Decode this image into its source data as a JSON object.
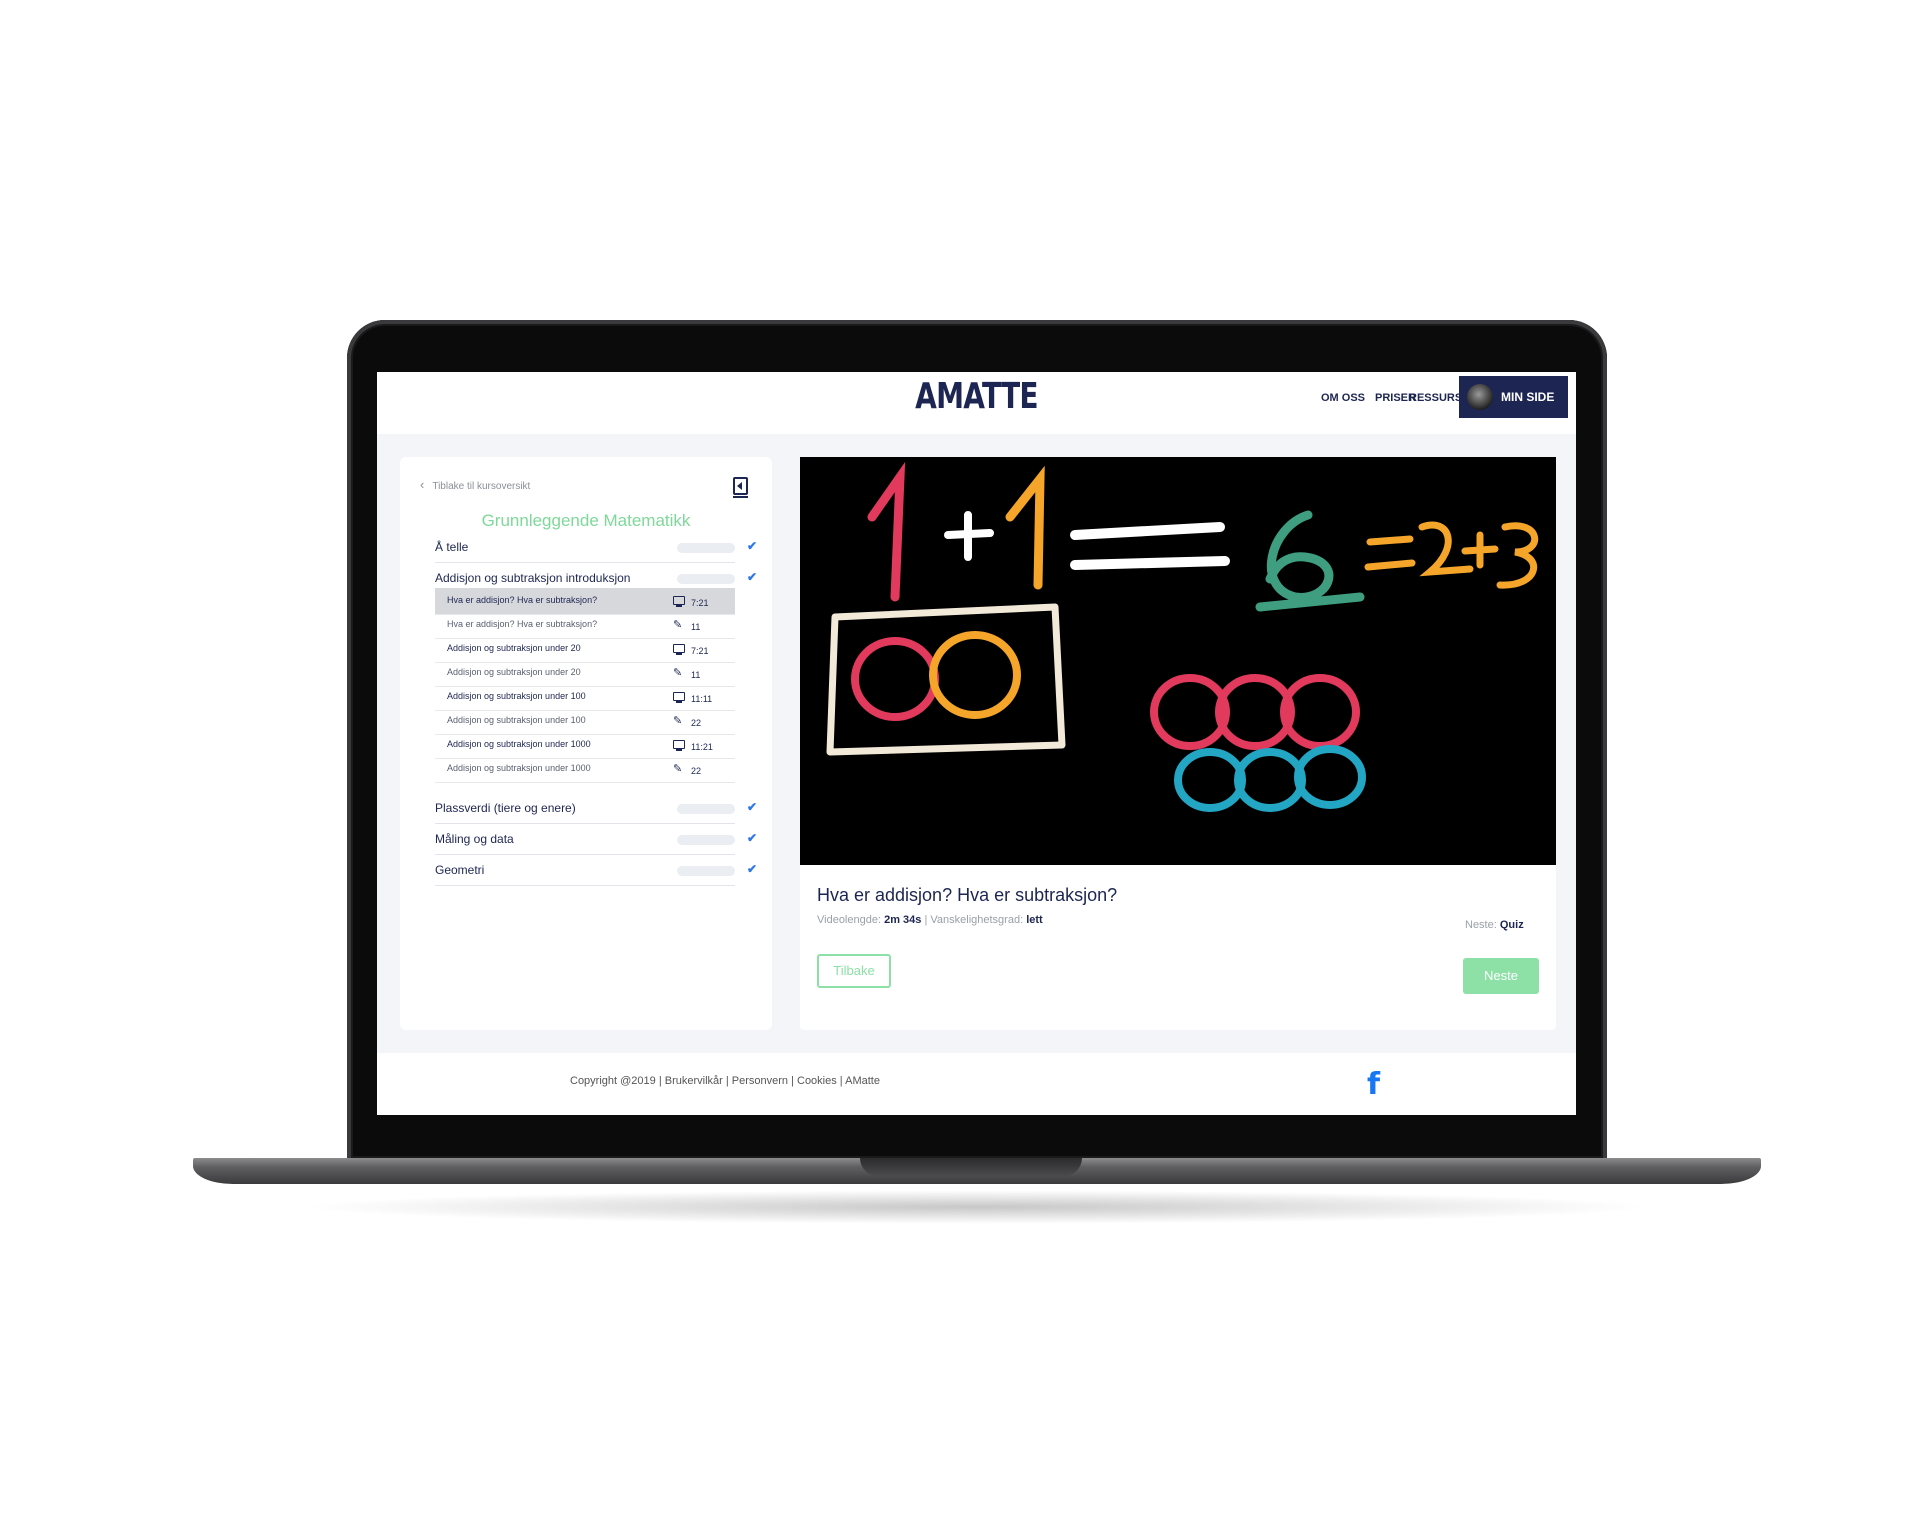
{
  "header": {
    "logo": "AMATTE",
    "nav": {
      "about": "OM OSS",
      "prices": "PRISER",
      "resources": "RESSURSER"
    },
    "min_side_label": "MIN SIDE"
  },
  "sidebar": {
    "back_link": "Tiblake til kursoversikt",
    "course_title": "Grunnleggende Matematikk",
    "sections": [
      {
        "label": "Å telle",
        "completed": true
      },
      {
        "label": "Addisjon og subtraksjon introduksjon",
        "completed": true,
        "lessons": [
          {
            "label": "Hva er addisjon? Hva er subtraksjon?",
            "type": "video",
            "value": "7:21",
            "active": true
          },
          {
            "label": "Hva er addisjon? Hva er subtraksjon?",
            "type": "quiz",
            "value": "11"
          },
          {
            "label": "Addisjon og subtraksjon under 20",
            "type": "video",
            "value": "7:21"
          },
          {
            "label": "Addisjon og subtraksjon under 20",
            "type": "quiz",
            "value": "11"
          },
          {
            "label": "Addisjon og subtraksjon under 100",
            "type": "video",
            "value": "11:11"
          },
          {
            "label": "Addisjon og subtraksjon under 100",
            "type": "quiz",
            "value": "22"
          },
          {
            "label": "Addisjon og subtraksjon under 1000",
            "type": "video",
            "value": "11:21"
          },
          {
            "label": "Addisjon og subtraksjon under 1000",
            "type": "quiz",
            "value": "22"
          }
        ]
      },
      {
        "label": "Plassverdi (tiere og enere)",
        "completed": true
      },
      {
        "label": "Måling og data",
        "completed": true
      },
      {
        "label": "Geometri",
        "completed": true
      }
    ]
  },
  "video": {
    "chalk_text": {
      "one": "1",
      "plus": "+",
      "equals": "=",
      "six": "6",
      "tail": "=2+3"
    }
  },
  "lesson": {
    "title": "Hva er addisjon? Hva er subtraksjon?",
    "length_label": "Videolengde:",
    "length_value": "2m 34s",
    "separator": "|",
    "difficulty_label": "Vanskelighetsgrad:",
    "difficulty_value": "lett",
    "next_label": "Neste:",
    "next_value": "Quiz",
    "back_button": "Tilbake",
    "next_button": "Neste"
  },
  "footer": {
    "copyright": "Copyright @2019 | Brukervilkår | Personvern | Cookies | AMatte",
    "facebook_glyph": "f"
  },
  "colors": {
    "navy": "#1d2652",
    "green": "#8de0a6",
    "check_blue": "#2d77e6",
    "facebook": "#1877f2"
  }
}
